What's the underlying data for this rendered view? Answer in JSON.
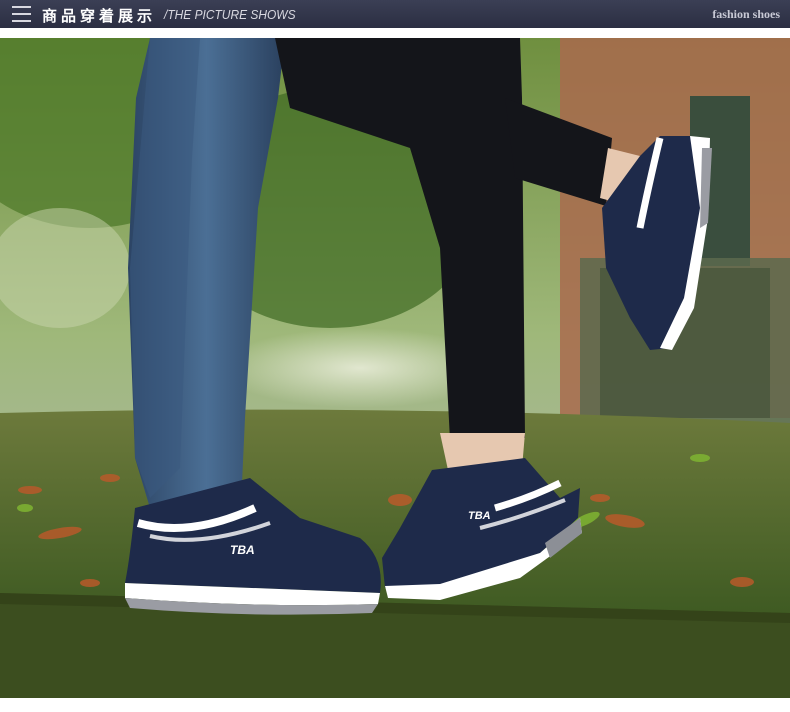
{
  "header": {
    "title_cn": "商品穿着展示",
    "title_en": "/THE PICTURE SHOWS",
    "right_text": "fashion shoes"
  },
  "photo": {
    "shoe_logo": "TBA"
  },
  "colors": {
    "header_bg": "#2f3247",
    "shoe_navy": "#1e2a4a",
    "grass": "#4d6a2a"
  }
}
